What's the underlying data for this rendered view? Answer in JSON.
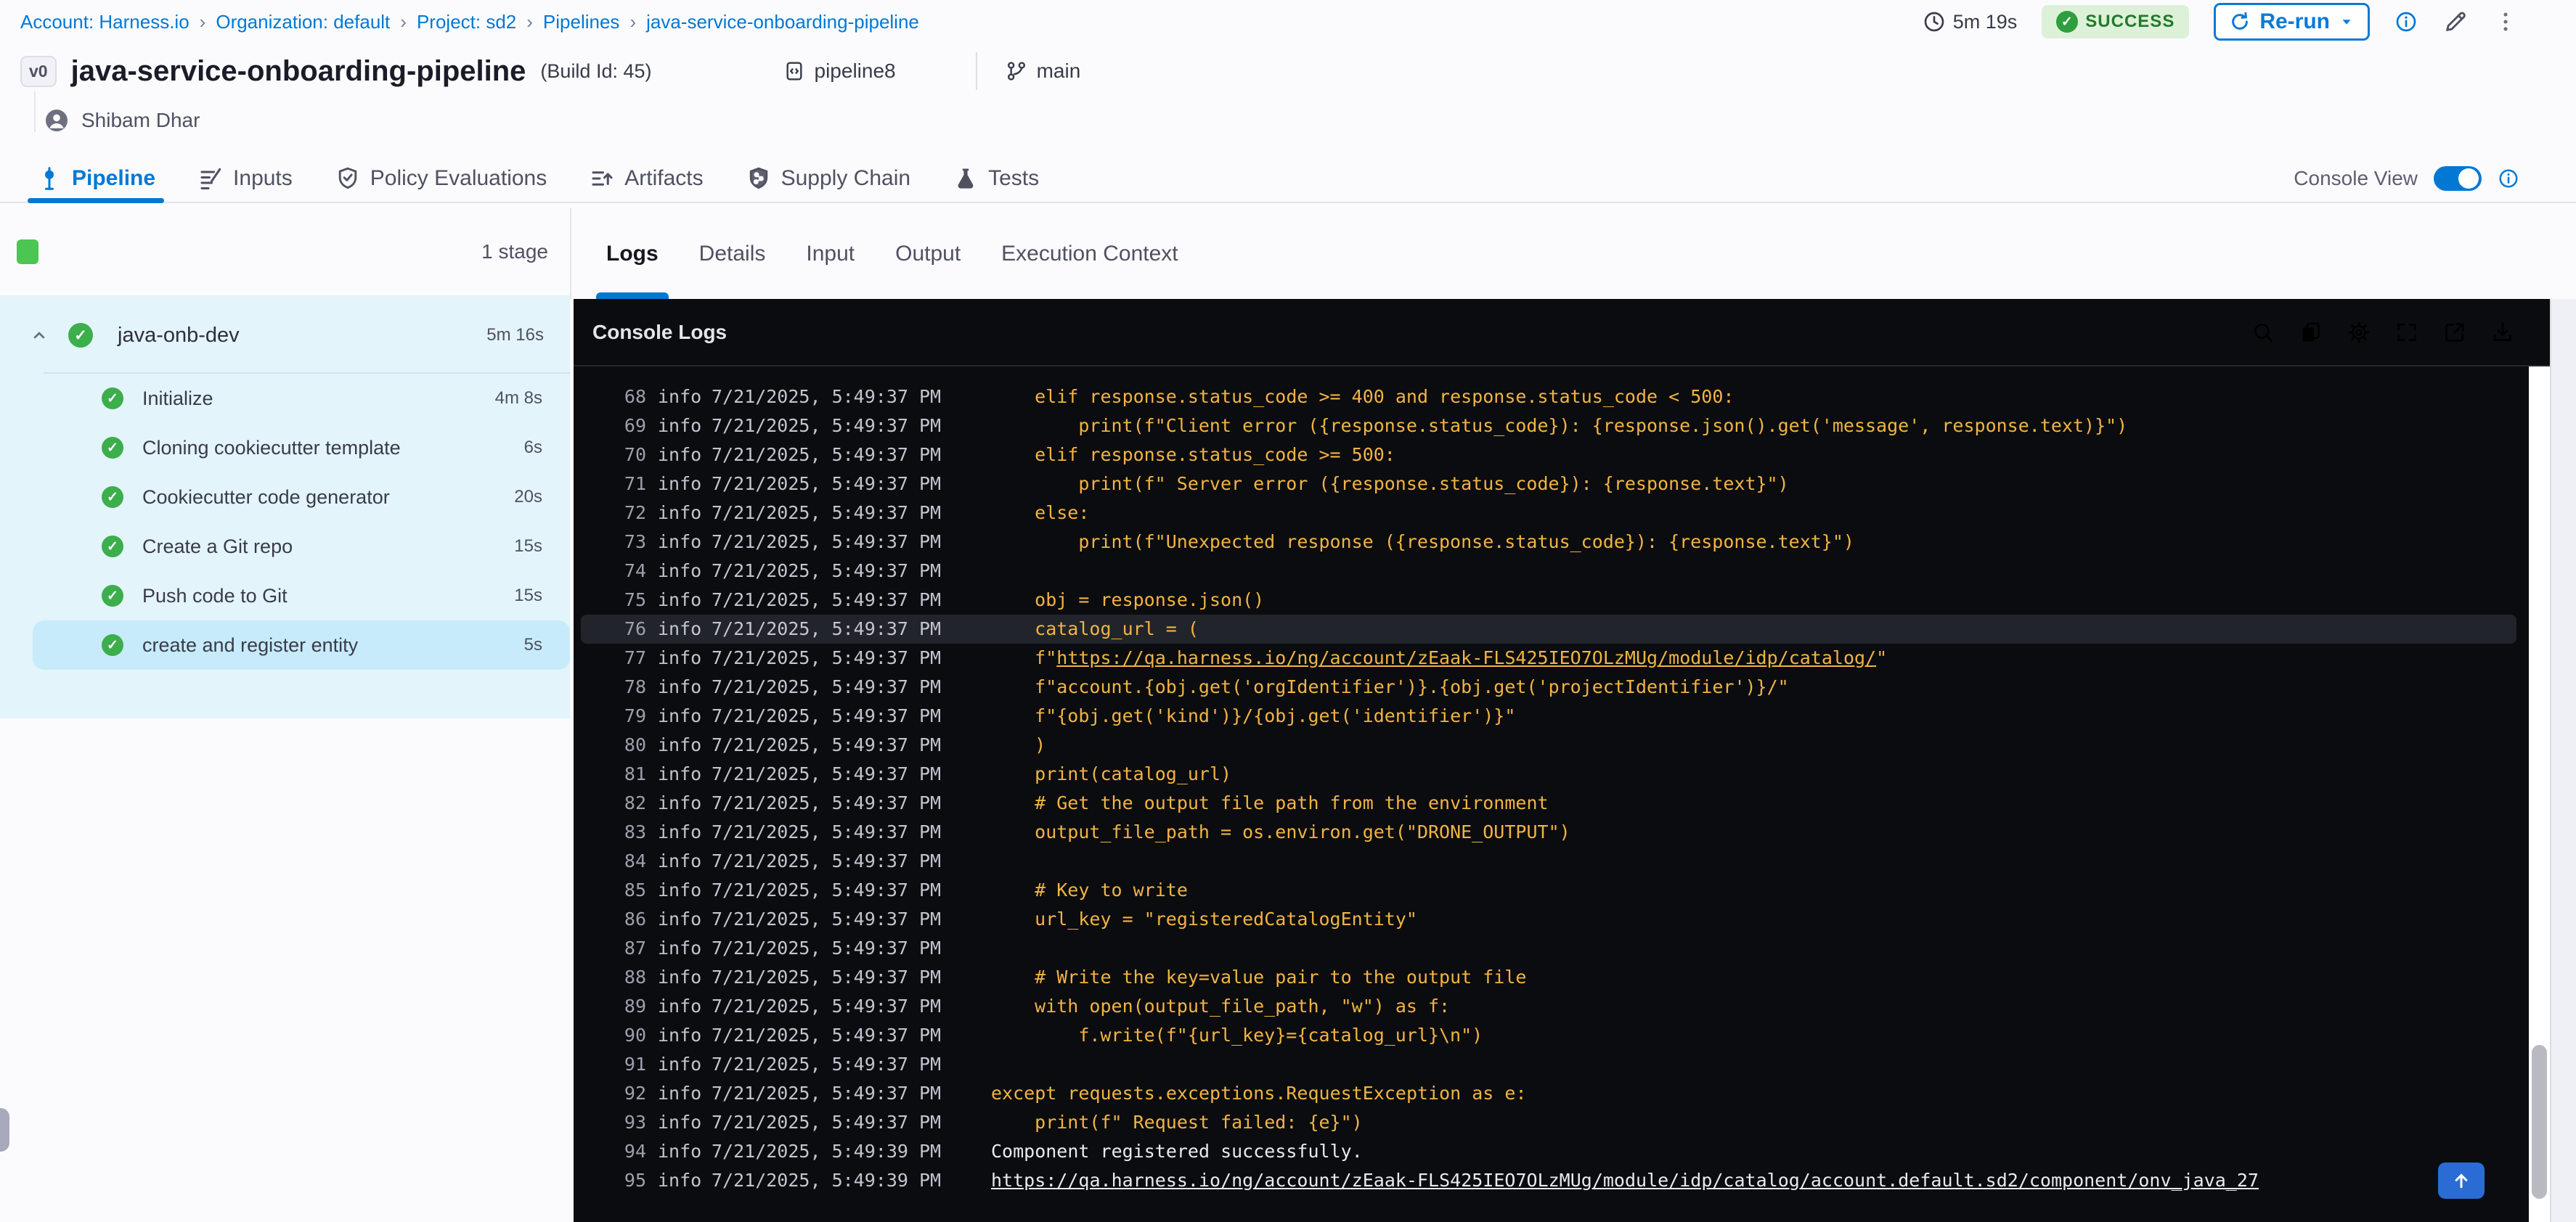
{
  "breadcrumb": {
    "separator": "›",
    "items": [
      "Account: Harness.io",
      "Organization: default",
      "Project: sd2",
      "Pipelines",
      "java-service-onboarding-pipeline"
    ]
  },
  "header": {
    "duration": "5m 19s",
    "status": "SUCCESS",
    "rerun_label": "Re-run",
    "version_badge": "v0",
    "title": "java-service-onboarding-pipeline",
    "build_id": "(Build Id: 45)",
    "repo": "pipeline8",
    "branch": "main",
    "user": "Shibam Dhar",
    "action_icons": [
      "info-icon",
      "edit-pencil-icon",
      "kebab-menu-icon"
    ]
  },
  "tabs": [
    {
      "label": "Pipeline",
      "icon": "pipeline-icon",
      "active": true
    },
    {
      "label": "Inputs",
      "icon": "inputs-icon",
      "active": false
    },
    {
      "label": "Policy Evaluations",
      "icon": "policy-shield-icon",
      "active": false
    },
    {
      "label": "Artifacts",
      "icon": "artifacts-icon",
      "active": false
    },
    {
      "label": "Supply Chain",
      "icon": "supply-chain-shield-icon",
      "active": false
    },
    {
      "label": "Tests",
      "icon": "tests-flask-icon",
      "active": false
    }
  ],
  "console_view": {
    "label": "Console View",
    "enabled": true
  },
  "sidebar": {
    "stage_count": "1 stage",
    "stage": {
      "name": "java-onb-dev",
      "duration": "5m 16s",
      "status": "success"
    },
    "steps": [
      {
        "name": "Initialize",
        "duration": "4m 8s",
        "selected": false
      },
      {
        "name": "Cloning cookiecutter template",
        "duration": "6s",
        "selected": false
      },
      {
        "name": "Cookiecutter code generator",
        "duration": "20s",
        "selected": false
      },
      {
        "name": "Create a Git repo",
        "duration": "15s",
        "selected": false
      },
      {
        "name": "Push code to Git",
        "duration": "15s",
        "selected": false
      },
      {
        "name": "create and register entity",
        "duration": "5s",
        "selected": true
      }
    ]
  },
  "log_panel": {
    "tabs": [
      "Logs",
      "Details",
      "Input",
      "Output",
      "Execution Context"
    ],
    "active_tab": "Logs",
    "title": "Console Logs",
    "action_icons": [
      "search-icon",
      "copy-icon",
      "settings-gear-icon",
      "fullscreen-icon",
      "open-in-new-icon",
      "download-icon"
    ],
    "lines": [
      {
        "n": 68,
        "lvl": "info",
        "ts": "7/21/2025, 5:49:37 PM",
        "indent": 4,
        "kind": "code",
        "text": "elif response.status_code >= 400 and response.status_code < 500:"
      },
      {
        "n": 69,
        "lvl": "info",
        "ts": "7/21/2025, 5:49:37 PM",
        "indent": 8,
        "kind": "code",
        "text": "print(f\"Client error ({response.status_code}): {response.json().get('message', response.text)}\")"
      },
      {
        "n": 70,
        "lvl": "info",
        "ts": "7/21/2025, 5:49:37 PM",
        "indent": 4,
        "kind": "code",
        "text": "elif response.status_code >= 500:"
      },
      {
        "n": 71,
        "lvl": "info",
        "ts": "7/21/2025, 5:49:37 PM",
        "indent": 8,
        "kind": "code",
        "text": "print(f\" Server error ({response.status_code}): {response.text}\")"
      },
      {
        "n": 72,
        "lvl": "info",
        "ts": "7/21/2025, 5:49:37 PM",
        "indent": 4,
        "kind": "code",
        "text": "else:"
      },
      {
        "n": 73,
        "lvl": "info",
        "ts": "7/21/2025, 5:49:37 PM",
        "indent": 8,
        "kind": "code",
        "text": "print(f\"Unexpected response ({response.status_code}): {response.text}\")"
      },
      {
        "n": 74,
        "lvl": "info",
        "ts": "7/21/2025, 5:49:37 PM",
        "indent": 0,
        "kind": "code",
        "text": ""
      },
      {
        "n": 75,
        "lvl": "info",
        "ts": "7/21/2025, 5:49:37 PM",
        "indent": 4,
        "kind": "code",
        "text": "obj = response.json()"
      },
      {
        "n": 76,
        "lvl": "info",
        "ts": "7/21/2025, 5:49:37 PM",
        "indent": 4,
        "kind": "code",
        "text": "catalog_url = (",
        "highlight": true
      },
      {
        "n": 77,
        "lvl": "info",
        "ts": "7/21/2025, 5:49:37 PM",
        "indent": 4,
        "kind": "code",
        "pre": "f\"",
        "link": "https://qa.harness.io/ng/account/zEaak-FLS425IEO7OLzMUg/module/idp/catalog/",
        "post": "\""
      },
      {
        "n": 78,
        "lvl": "info",
        "ts": "7/21/2025, 5:49:37 PM",
        "indent": 4,
        "kind": "code",
        "text": "f\"account.{obj.get('orgIdentifier')}.{obj.get('projectIdentifier')}/\""
      },
      {
        "n": 79,
        "lvl": "info",
        "ts": "7/21/2025, 5:49:37 PM",
        "indent": 4,
        "kind": "code",
        "text": "f\"{obj.get('kind')}/{obj.get('identifier')}\""
      },
      {
        "n": 80,
        "lvl": "info",
        "ts": "7/21/2025, 5:49:37 PM",
        "indent": 4,
        "kind": "code",
        "text": ")"
      },
      {
        "n": 81,
        "lvl": "info",
        "ts": "7/21/2025, 5:49:37 PM",
        "indent": 4,
        "kind": "code",
        "text": "print(catalog_url)"
      },
      {
        "n": 82,
        "lvl": "info",
        "ts": "7/21/2025, 5:49:37 PM",
        "indent": 4,
        "kind": "code",
        "text": "# Get the output file path from the environment"
      },
      {
        "n": 83,
        "lvl": "info",
        "ts": "7/21/2025, 5:49:37 PM",
        "indent": 4,
        "kind": "code",
        "text": "output_file_path = os.environ.get(\"DRONE_OUTPUT\")"
      },
      {
        "n": 84,
        "lvl": "info",
        "ts": "7/21/2025, 5:49:37 PM",
        "indent": 0,
        "kind": "code",
        "text": ""
      },
      {
        "n": 85,
        "lvl": "info",
        "ts": "7/21/2025, 5:49:37 PM",
        "indent": 4,
        "kind": "code",
        "text": "# Key to write"
      },
      {
        "n": 86,
        "lvl": "info",
        "ts": "7/21/2025, 5:49:37 PM",
        "indent": 4,
        "kind": "code",
        "text": "url_key = \"registeredCatalogEntity\""
      },
      {
        "n": 87,
        "lvl": "info",
        "ts": "7/21/2025, 5:49:37 PM",
        "indent": 0,
        "kind": "code",
        "text": ""
      },
      {
        "n": 88,
        "lvl": "info",
        "ts": "7/21/2025, 5:49:37 PM",
        "indent": 4,
        "kind": "code",
        "text": "# Write the key=value pair to the output file"
      },
      {
        "n": 89,
        "lvl": "info",
        "ts": "7/21/2025, 5:49:37 PM",
        "indent": 4,
        "kind": "code",
        "text": "with open(output_file_path, \"w\") as f:"
      },
      {
        "n": 90,
        "lvl": "info",
        "ts": "7/21/2025, 5:49:37 PM",
        "indent": 8,
        "kind": "code",
        "text": "f.write(f\"{url_key}={catalog_url}\\n\")"
      },
      {
        "n": 91,
        "lvl": "info",
        "ts": "7/21/2025, 5:49:37 PM",
        "indent": 0,
        "kind": "code",
        "text": ""
      },
      {
        "n": 92,
        "lvl": "info",
        "ts": "7/21/2025, 5:49:37 PM",
        "indent": 0,
        "kind": "code",
        "text": "except requests.exceptions.RequestException as e:"
      },
      {
        "n": 93,
        "lvl": "info",
        "ts": "7/21/2025, 5:49:37 PM",
        "indent": 4,
        "kind": "code",
        "text": "print(f\" Request failed: {e}\")"
      },
      {
        "n": 94,
        "lvl": "info",
        "ts": "7/21/2025, 5:49:39 PM",
        "indent": 0,
        "kind": "plain",
        "text": "Component registered successfully."
      },
      {
        "n": 95,
        "lvl": "info",
        "ts": "7/21/2025, 5:49:39 PM",
        "indent": 0,
        "kind": "plain",
        "link": "https://qa.harness.io/ng/account/zEaak-FLS425IEO7OLzMUg/module/idp/catalog/account.default.sd2/component/onv_java_27"
      }
    ]
  },
  "colors": {
    "accent_blue": "#0278d5",
    "success_green": "#3cae4c",
    "stage_square_green": "#4cc552",
    "status_badge_bg": "#ddf1d8",
    "status_badge_text": "#227a2b",
    "sidebar_stage_bg": "#e3f4fb",
    "selected_step_bg": "#c7ebfa",
    "console_bg": "#0b0c0f",
    "log_code_yellow": "#f1b443",
    "log_plain_white": "#e9eaef",
    "log_meta_gray": "#c3c4cf"
  }
}
